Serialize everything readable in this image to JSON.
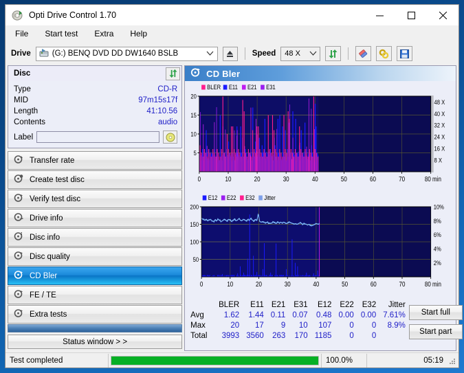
{
  "window": {
    "title": "Opti Drive Control 1.70",
    "icon": "disc-icon",
    "minimize": "minimize-icon",
    "maximize": "maximize-icon",
    "close": "close-icon"
  },
  "menu": {
    "items": [
      "File",
      "Start test",
      "Extra",
      "Help"
    ]
  },
  "toolbar": {
    "drive_label": "Drive",
    "drive_value": "(G:)  BENQ DVD DD DW1640 BSLB",
    "drive_letter": "(G:)",
    "drive_name": "BENQ DVD DD DW1640 BSLB",
    "eject": "eject-icon",
    "speed_label": "Speed",
    "speed_value": "48 X",
    "refresh": "refresh-icon",
    "erase": "erase-icon",
    "settings": "gear-icon",
    "save": "save-icon"
  },
  "disc": {
    "header": "Disc",
    "refresh_icon": "refresh-icon",
    "rows": [
      {
        "key": "Type",
        "value": "CD-R"
      },
      {
        "key": "MID",
        "value": "97m15s17f"
      },
      {
        "key": "Length",
        "value": "41:10.56"
      },
      {
        "key": "Contents",
        "value": "audio"
      }
    ],
    "label_key": "Label",
    "label_value": "",
    "label_placeholder": "",
    "cd_icon": "cd-icon"
  },
  "nav": {
    "items": [
      {
        "label": "Transfer rate",
        "icon": "disc-rate-icon",
        "selected": false
      },
      {
        "label": "Create test disc",
        "icon": "disc-create-icon",
        "selected": false
      },
      {
        "label": "Verify test disc",
        "icon": "disc-verify-icon",
        "selected": false
      },
      {
        "label": "Drive info",
        "icon": "disc-drive-icon",
        "selected": false
      },
      {
        "label": "Disc info",
        "icon": "disc-info-icon",
        "selected": false
      },
      {
        "label": "Disc quality",
        "icon": "disc-quality-icon",
        "selected": false
      },
      {
        "label": "CD Bler",
        "icon": "disc-bler-icon",
        "selected": true
      },
      {
        "label": "FE / TE",
        "icon": "disc-fete-icon",
        "selected": false
      },
      {
        "label": "Extra tests",
        "icon": "disc-extra-icon",
        "selected": false
      }
    ],
    "status_window": "Status window > >"
  },
  "panel": {
    "title": "CD Bler",
    "icon": "disc-bler-icon"
  },
  "chart_data": [
    {
      "type": "bar",
      "title": "CD Bler - error rates",
      "xlabel": "min",
      "ylabel": "",
      "xlim": [
        0,
        80
      ],
      "ylim": [
        0,
        20
      ],
      "xticks": [
        0,
        10,
        20,
        30,
        40,
        50,
        60,
        70,
        80
      ],
      "xtick_labels": [
        "0",
        "10",
        "20",
        "30",
        "40",
        "50",
        "60",
        "70",
        "80 min"
      ],
      "yticks": [
        5,
        10,
        15,
        20
      ],
      "ytick_labels": [
        "5",
        "10",
        "15",
        "20"
      ],
      "y2label": "",
      "y2lim": [
        0,
        52
      ],
      "y2ticks": [
        8,
        16,
        24,
        32,
        40,
        48
      ],
      "y2tick_labels": [
        "8 X",
        "16 X",
        "24 X",
        "32 X",
        "40 X",
        "48 X"
      ],
      "grid": true,
      "legend_position": "top-left",
      "legend": [
        {
          "name": "BLER",
          "color": "#ff1d8e"
        },
        {
          "name": "E11",
          "color": "#1a1aff"
        },
        {
          "name": "E21",
          "color": "#c01ef0"
        },
        {
          "name": "E31",
          "color": "#9b1ef0"
        }
      ],
      "data_extent_min": 41.2,
      "plot_bg": "#0b0b52",
      "series": [
        {
          "name": "E11",
          "color": "#1a1aff",
          "values": [
            5,
            4,
            3,
            6,
            4,
            3,
            5,
            11,
            4,
            3,
            6,
            3,
            4,
            5,
            3,
            4,
            6,
            3,
            4,
            5,
            4,
            3,
            15,
            4,
            3,
            12,
            5,
            4,
            3,
            6,
            4,
            8,
            5,
            4,
            3,
            5,
            4,
            6,
            3,
            4,
            12,
            5,
            4,
            3,
            12,
            5,
            9,
            4,
            3,
            6,
            5,
            4,
            3,
            5,
            4,
            6,
            3,
            17,
            5,
            4,
            8,
            3,
            4,
            5,
            9,
            4,
            3,
            7,
            5,
            4,
            14,
            3,
            4,
            5,
            4,
            3,
            6,
            4,
            5,
            3,
            9,
            7,
            4,
            3,
            14,
            5,
            15,
            4,
            3,
            12,
            5,
            4,
            11,
            3,
            6,
            4,
            13,
            5,
            4,
            3,
            16,
            5,
            4,
            14,
            3,
            5,
            4,
            7,
            3,
            11,
            4,
            5,
            3,
            13,
            4,
            6,
            3,
            5,
            4,
            3,
            7,
            5,
            4,
            3,
            18,
            12,
            5,
            4
          ]
        },
        {
          "name": "BLER",
          "color": "#ff1d8e",
          "values": [
            7,
            5,
            4,
            6,
            5,
            4,
            6,
            5,
            4,
            6,
            5,
            4,
            6,
            5,
            4,
            6,
            20,
            5,
            4,
            10,
            6,
            5,
            12,
            12,
            6,
            5,
            4,
            6,
            5,
            4,
            19,
            16,
            5,
            4,
            6,
            5,
            4,
            11,
            6,
            5,
            12,
            12,
            6,
            5,
            4,
            6,
            5,
            4,
            15,
            6,
            5,
            15,
            11,
            6,
            5,
            4,
            6,
            5,
            4,
            15,
            6,
            5,
            16,
            14,
            6,
            5,
            4,
            6,
            5,
            4,
            12,
            6,
            5,
            4,
            6,
            5,
            4,
            6,
            5,
            4,
            20,
            6,
            5,
            4
          ]
        }
      ]
    },
    {
      "type": "line",
      "title": "CD Bler - E12/E22/E32 and Jitter",
      "xlabel": "min",
      "ylabel": "",
      "xlim": [
        0,
        80
      ],
      "ylim": [
        0,
        200
      ],
      "xticks": [
        0,
        10,
        20,
        30,
        40,
        50,
        60,
        70,
        80
      ],
      "xtick_labels": [
        "0",
        "10",
        "20",
        "30",
        "40",
        "50",
        "60",
        "70",
        "80 min"
      ],
      "yticks": [
        50,
        100,
        150,
        200
      ],
      "ytick_labels": [
        "50",
        "100",
        "150",
        "200"
      ],
      "y2lim": [
        0,
        10
      ],
      "y2ticks": [
        2,
        4,
        6,
        8,
        10
      ],
      "y2tick_labels": [
        "2%",
        "4%",
        "6%",
        "8%",
        "10%"
      ],
      "grid": true,
      "legend_position": "top-left",
      "legend": [
        {
          "name": "E12",
          "color": "#1a1aff"
        },
        {
          "name": "E22",
          "color": "#9b1ef0"
        },
        {
          "name": "E32",
          "color": "#ff1d8e"
        },
        {
          "name": "Jitter",
          "color": "#7d9fe8"
        }
      ],
      "data_extent_min": 41.2,
      "plot_bg": "#0b0b52",
      "jitter_series": {
        "name": "Jitter",
        "color": "#79b4f5",
        "unit": "%",
        "values_pct": [
          8.4,
          8.2,
          8.1,
          8.2,
          8.0,
          8.1,
          8.2,
          8.0,
          7.9,
          8.1,
          8.0,
          8.2,
          8.1,
          7.9,
          8.0,
          8.2,
          8.1,
          8.0,
          8.2,
          8.1,
          7.9,
          8.1,
          8.2,
          8.0,
          8.1,
          8.3,
          8.1,
          8.0,
          8.2,
          8.1,
          8.0,
          8.2,
          8.1,
          8.3,
          8.1,
          8.0,
          8.2,
          8.1,
          8.9,
          7.9,
          7.8,
          7.9,
          7.8,
          7.7,
          7.8,
          7.7,
          7.6,
          7.7,
          7.8,
          7.7,
          7.6,
          7.8,
          7.7,
          7.8,
          7.7,
          7.8,
          7.7,
          7.6,
          7.7,
          7.8,
          7.7,
          7.6,
          7.5,
          7.6,
          7.5,
          7.6,
          7.7,
          7.6,
          7.5,
          7.6,
          7.5,
          7.4,
          7.5,
          7.4,
          7.3,
          7.4,
          7.5,
          7.6,
          7.5,
          7.6
        ]
      },
      "e12_spikes": [
        {
          "min": 7.2,
          "value": 8
        },
        {
          "min": 12.5,
          "value": 10
        },
        {
          "min": 13.4,
          "value": 30
        },
        {
          "min": 14.6,
          "value": 12
        },
        {
          "min": 16.0,
          "value": 52
        },
        {
          "min": 16.7,
          "value": 178
        },
        {
          "min": 18.0,
          "value": 60
        },
        {
          "min": 19.2,
          "value": 14
        },
        {
          "min": 21.3,
          "value": 22
        },
        {
          "min": 21.8,
          "value": 96
        },
        {
          "min": 24.0,
          "value": 12
        },
        {
          "min": 25.9,
          "value": 95
        },
        {
          "min": 29.5,
          "value": 22
        },
        {
          "min": 31.5,
          "value": 107
        },
        {
          "min": 32.6,
          "value": 40
        },
        {
          "min": 33.4,
          "value": 30
        },
        {
          "min": 36.5,
          "value": 12
        },
        {
          "min": 39.0,
          "value": 10
        },
        {
          "min": 40.4,
          "value": 18
        }
      ]
    }
  ],
  "stats": {
    "columns": [
      "BLER",
      "E11",
      "E21",
      "E31",
      "E12",
      "E22",
      "E32",
      "Jitter"
    ],
    "rows": [
      {
        "label": "Avg",
        "values": [
          "1.62",
          "1.44",
          "0.11",
          "0.07",
          "0.48",
          "0.00",
          "0.00",
          "7.61%"
        ]
      },
      {
        "label": "Max",
        "values": [
          "20",
          "17",
          "9",
          "10",
          "107",
          "0",
          "0",
          "8.9%"
        ]
      },
      {
        "label": "Total",
        "values": [
          "3993",
          "3560",
          "263",
          "170",
          "1185",
          "0",
          "0",
          ""
        ]
      }
    ]
  },
  "actions": {
    "start_full": "Start full",
    "start_part": "Start part"
  },
  "statusbar": {
    "message": "Test completed",
    "progress_pct": 100,
    "progress_text": "100.0%",
    "elapsed": "05:19"
  },
  "colors": {
    "accent": "#1b8ada",
    "value_text": "#2020c8",
    "progress": "#06b025",
    "plot_bg": "#0b0b52",
    "bler": "#ff1d8e",
    "e11": "#1a1aff",
    "e21": "#c01ef0",
    "e31": "#9b1ef0",
    "jitter": "#79b4f5"
  }
}
